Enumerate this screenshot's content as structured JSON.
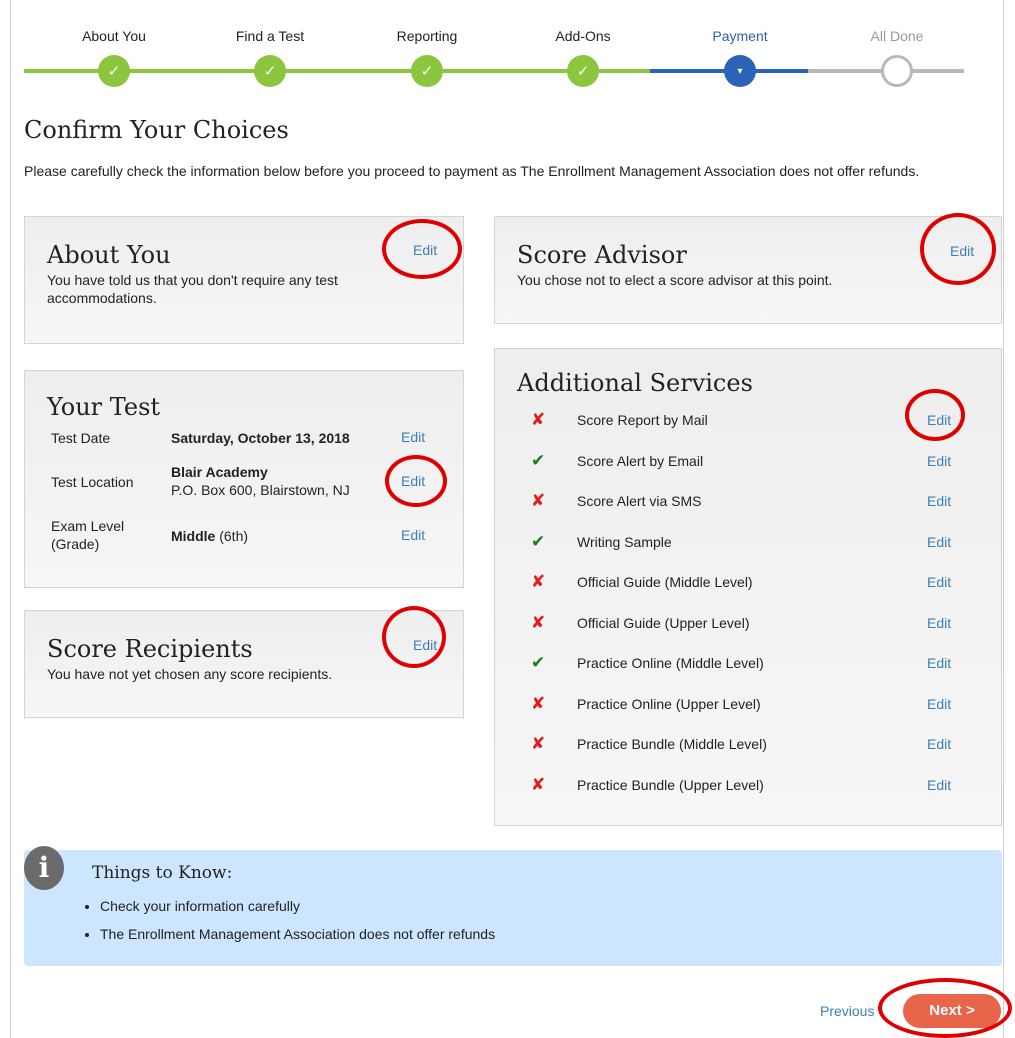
{
  "steps": [
    {
      "label": "About You",
      "state": "done"
    },
    {
      "label": "Find a Test",
      "state": "done"
    },
    {
      "label": "Reporting",
      "state": "done"
    },
    {
      "label": "Add-Ons",
      "state": "done"
    },
    {
      "label": "Payment",
      "state": "active"
    },
    {
      "label": "All Done",
      "state": "future"
    }
  ],
  "check_glyph": "✓",
  "active_glyph": "▾",
  "page_title": "Confirm Your Choices",
  "intro": "Please carefully check the information below before you proceed to payment as The Enrollment Management Association does not offer refunds.",
  "edit_label": "Edit",
  "about_you": {
    "title": "About You",
    "text": "You have told us that you don't require any test accommodations."
  },
  "score_advisor": {
    "title": "Score Advisor",
    "text": "You chose not to elect a score advisor at this point."
  },
  "your_test": {
    "title": "Your Test",
    "rows": [
      {
        "label": "Test Date",
        "value_bold": "Saturday, October 13, 2018",
        "value_rest": ""
      },
      {
        "label": "Test Location",
        "value_bold": "Blair Academy",
        "value_rest": "P.O. Box 600, Blairstown, NJ"
      },
      {
        "label": "Exam Level (Grade)",
        "value_bold": "Middle",
        "value_rest": " (6th)"
      }
    ]
  },
  "score_recipients": {
    "title": "Score Recipients",
    "text": "You have not yet chosen any score recipients."
  },
  "additional_services": {
    "title": "Additional Services",
    "yes_glyph": "✔",
    "no_glyph": "✘",
    "items": [
      {
        "label": "Score Report by Mail",
        "selected": false
      },
      {
        "label": "Score Alert by Email",
        "selected": true
      },
      {
        "label": "Score Alert via SMS",
        "selected": false
      },
      {
        "label": "Writing Sample",
        "selected": true
      },
      {
        "label": "Official Guide (Middle Level)",
        "selected": false
      },
      {
        "label": "Official Guide (Upper Level)",
        "selected": false
      },
      {
        "label": "Practice Online (Middle Level)",
        "selected": true
      },
      {
        "label": "Practice Online (Upper Level)",
        "selected": false
      },
      {
        "label": "Practice Bundle (Middle Level)",
        "selected": false
      },
      {
        "label": "Practice Bundle (Upper Level)",
        "selected": false
      }
    ]
  },
  "things_to_know": {
    "icon_glyph": "i",
    "title": "Things to Know:",
    "items": [
      "Check your information carefully",
      "The Enrollment Management Association does not offer refunds"
    ]
  },
  "footer": {
    "previous_label": "Previous",
    "next_label": "Next >"
  },
  "colors": {
    "done": "#8cc63f",
    "active": "#2a63b7",
    "future": "#b9b9b9",
    "annotation": "#e00000",
    "next_button": "#e8654a"
  }
}
